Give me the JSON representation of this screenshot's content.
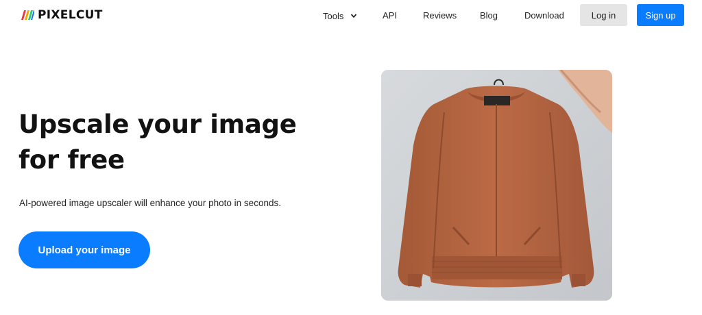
{
  "brand": {
    "name": "PIXELCUT",
    "colors": [
      "#e63946",
      "#f4a300",
      "#2ecc71",
      "#1e6fff"
    ]
  },
  "nav": {
    "tools": "Tools",
    "api": "API",
    "reviews": "Reviews",
    "blog": "Blog",
    "download": "Download",
    "login": "Log in",
    "signup": "Sign up"
  },
  "hero": {
    "title": "Upscale your image for free",
    "subtitle": "AI-powered image upscaler will enhance your photo in seconds.",
    "cta": "Upload your image",
    "image_alt_icon": "jacket-photo"
  },
  "colors": {
    "accent": "#0a7cff",
    "login_bg": "#e5e5e5",
    "jacket": "#b4643f"
  }
}
